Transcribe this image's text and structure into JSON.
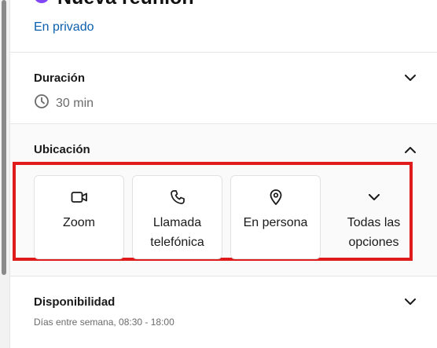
{
  "header": {
    "title": "Nueva reunión",
    "privacy_link": "En privado",
    "accent_color": "#8247f5"
  },
  "duration": {
    "label": "Duración",
    "value": "30 min",
    "icon": "clock-icon",
    "toggle_icon": "chevron-down-icon"
  },
  "location": {
    "label": "Ubicación",
    "toggle_icon": "chevron-up-icon",
    "highlight_color": "#e01b1b",
    "options": [
      {
        "label": "Zoom",
        "icon": "video-camera-icon"
      },
      {
        "label": "Llamada telefónica",
        "icon": "phone-icon"
      },
      {
        "label": "En persona",
        "icon": "map-pin-icon"
      },
      {
        "label": "Todas las opciones",
        "icon": "chevron-down-icon"
      }
    ]
  },
  "availability": {
    "label": "Disponibilidad",
    "value": "Días entre semana, 08:30 - 18:00",
    "toggle_icon": "chevron-down-icon"
  }
}
